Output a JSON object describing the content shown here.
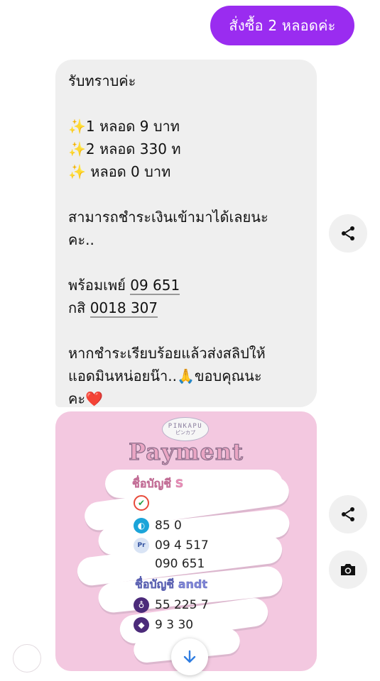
{
  "outgoing_message": {
    "text": "สั่งซื้อ 2 หลอดค่ะ"
  },
  "incoming_message": {
    "greeting": "รับทราบค่ะ",
    "price_line_1": "✨1 หลอด  9 บาท",
    "price_line_2": "✨2 หลอด 330  ท",
    "price_line_3": "✨  หลอด  0 บาท",
    "pay_line_1": "สามารถชำระเงินเข้ามาได้เลยนะ",
    "pay_line_2": "คะ..",
    "prompt_pay": "พร้อมเพย์",
    "prompt_pay_num": "09  651",
    "bank_prefix": "กสิ",
    "bank_num": "0018  307",
    "after_line_1": "หากชำระเรียบร้อยแล้วส่งสลิปให้",
    "after_line_2": "แอดมินหน่อยน๊า..🙏ขอบคุณนะ",
    "after_line_3": "คะ❤️"
  },
  "image_message": {
    "logo_text": "PINKAPU",
    "logo_sub": "ピンカプ",
    "title": "Payment",
    "account_label_1": "ชื่อบัญชี S",
    "account_label_2": "ชื่อบัญชี andt",
    "rows": [
      "85  0",
      "09  4 517",
      "090  651",
      "55  225  7",
      "9  3 30"
    ],
    "background": "#f3c8e0"
  },
  "colors": {
    "accent": "#9a2cf0",
    "bubble_gray": "#efefef"
  },
  "icons": {
    "share": "share-icon",
    "camera": "camera-icon",
    "scroll": "arrow-down-icon"
  }
}
